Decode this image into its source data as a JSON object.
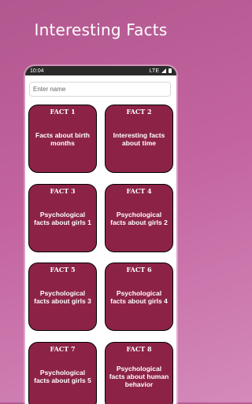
{
  "header": {
    "title": "Interesting Facts"
  },
  "status_bar": {
    "time": "10:04",
    "network": "LTE"
  },
  "search": {
    "placeholder": "Enter name",
    "value": ""
  },
  "cards": [
    {
      "label": "FACT 1",
      "text": "Facts about birth months"
    },
    {
      "label": "FACT 2",
      "text": "Interesting facts about time"
    },
    {
      "label": "FACT 3",
      "text": "Psychological facts about girls 1"
    },
    {
      "label": "FACT 4",
      "text": "Psychological facts about girls 2"
    },
    {
      "label": "FACT 5",
      "text": "Psychological facts about girls 3"
    },
    {
      "label": "FACT 6",
      "text": "Psychological facts about girls 4"
    },
    {
      "label": "FACT 7",
      "text": "Psychological facts about girls 5"
    },
    {
      "label": "FACT 8",
      "text": "Psychological facts about human behavior"
    }
  ],
  "colors": {
    "card": "#8c2347",
    "background": "#c3649f"
  }
}
